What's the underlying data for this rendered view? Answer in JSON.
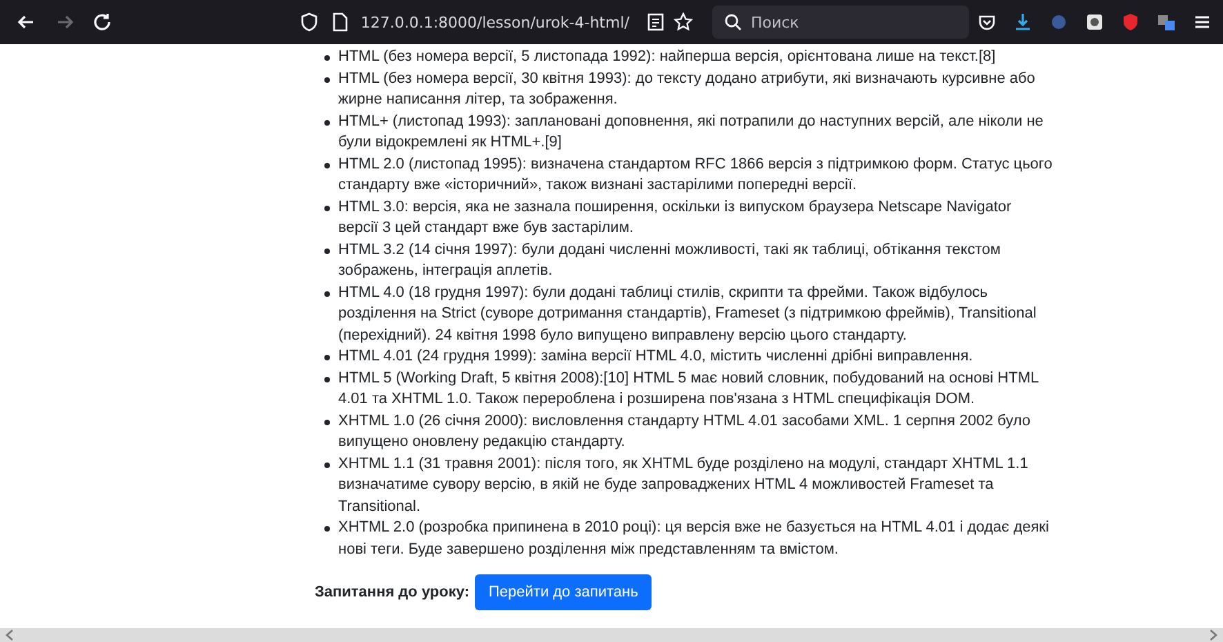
{
  "toolbar": {
    "nav": [
      {
        "kind": "back",
        "disabled": false
      },
      {
        "kind": "forward",
        "disabled": true
      },
      {
        "kind": "reload",
        "disabled": false
      }
    ],
    "url": "127.0.0.1:8000/lesson/urok-4-html/",
    "search": {
      "placeholder": "Поиск"
    }
  },
  "versions": [
    "HTML (без номера версії, 5 листопада 1992): найперша версія, орієнтована лише на текст.[8]",
    "HTML (без номера версії, 30 квітня 1993): до тексту додано атрибути, які визначають курсивне або жирне написання літер, та зображення.",
    "HTML+ (листопад 1993): заплановані доповнення, які потрапили до наступних версій, але ніколи не були відокремлені як HTML+.[9]",
    "HTML 2.0 (листопад 1995): визначена стандартом RFC 1866 версія з підтримкою форм. Статус цього стандарту вже «історичний», також визнані застарілими попередні версії.",
    "HTML 3.0: версія, яка не зазнала поширення, оскільки із випуском браузера Netscape Navigator версії 3 цей стандарт вже був застарілим.",
    "HTML 3.2 (14 січня 1997): були додані численні можливості, такі як таблиці, обтікання текстом зображень, інтеграція аплетів.",
    "HTML 4.0 (18 грудня 1997): були додані таблиці стилів, скрипти та фрейми. Також відбулось розділення на Strict (суворе дотримання стандартів), Frameset (з підтримкою фреймів), Transitional (перехідний). 24 квітня 1998 було випущено виправлену версію цього стандарту.",
    "HTML 4.01 (24 грудня 1999): заміна версії HTML 4.0, містить численні дрібні виправлення.",
    "HTML 5 (Working Draft, 5 квітня 2008):[10] HTML 5 має новий словник, побудований на основі HTML 4.01 та XHTML 1.0. Також перероблена і розширена пов'язана з HTML специфікація DOM.",
    "XHTML 1.0 (26 січня 2000): висловлення стандарту HTML 4.01 засобами XML. 1 серпня 2002 було випущено оновлену редакцію стандарту.",
    "XHTML 1.1 (31 травня 2001): після того, як XHTML буде розділено на модулі, стандарт XHTML 1.1 визначатиме сувору версію, в якій не буде запроваджених HTML 4 можливостей Frameset та Transitional.",
    "XHTML 2.0 (розробка припинена в 2010 році): ця версія вже не базується на HTML 4.01 і додає деякі нові теги. Буде завершено розділення між представленням та вмістом."
  ],
  "questions": {
    "label": "Запитання до уроку:",
    "button": "Перейти до запитань"
  }
}
